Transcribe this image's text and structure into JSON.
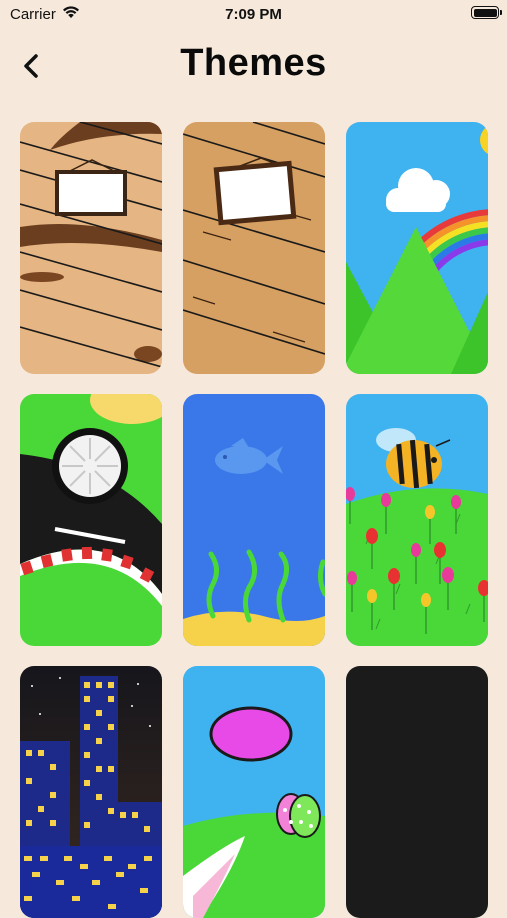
{
  "status_bar": {
    "carrier": "Carrier",
    "time": "7:09 PM"
  },
  "header": {
    "title": "Themes",
    "back_icon": "chevron-left-icon"
  },
  "themes": [
    {
      "name": "wood-light"
    },
    {
      "name": "wood-dark"
    },
    {
      "name": "rainbow-hills"
    },
    {
      "name": "race-track"
    },
    {
      "name": "underwater"
    },
    {
      "name": "bee-garden"
    },
    {
      "name": "night-city"
    },
    {
      "name": "easter"
    },
    {
      "name": "black"
    }
  ],
  "colors": {
    "background": "#f6e9dc",
    "title": "#0a0a0a"
  }
}
